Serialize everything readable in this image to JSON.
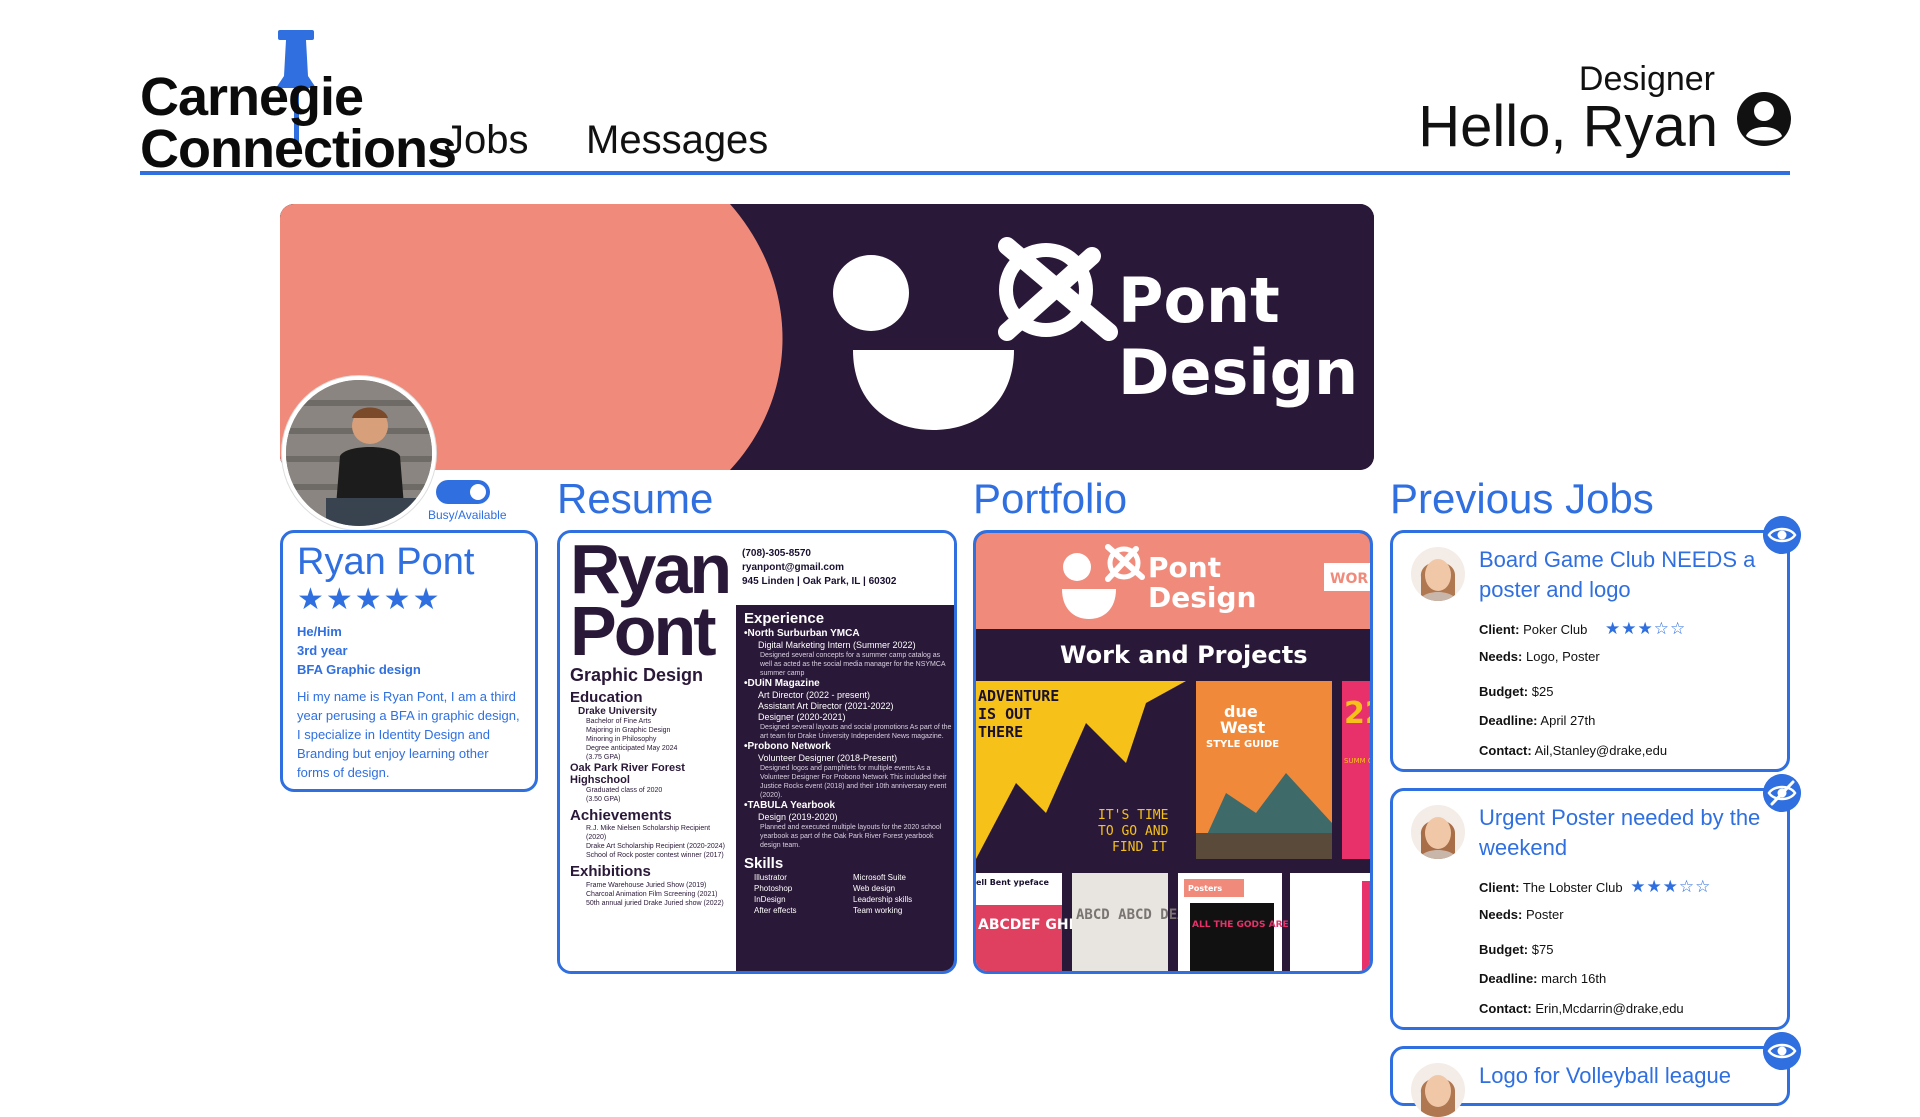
{
  "brand": {
    "line1": "Carnegie",
    "line2": "Connections"
  },
  "nav": {
    "jobs": "Jobs",
    "messages": "Messages"
  },
  "user": {
    "role": "Designer",
    "greeting": "Hello, Ryan"
  },
  "banner": {
    "brand_line1": "Pont",
    "brand_line2": "Design"
  },
  "status": {
    "toggle_label": "Busy/Available",
    "available": true
  },
  "sections": {
    "resume": "Resume",
    "portfolio": "Portfolio",
    "previous_jobs": "Previous Jobs"
  },
  "profile": {
    "name": "Ryan Pont",
    "rating": "★★★★★",
    "pronouns": "He/Him",
    "year": "3rd year",
    "program": "BFA Graphic design",
    "bio": "Hi my name is Ryan Pont, I am a third year perusing a BFA in graphic design, I specialize in Identity Design and Branding but enjoy learning other forms of design."
  },
  "resume": {
    "name_line1": "Ryan",
    "name_line2": "Pont",
    "subtitle": "Graphic Design",
    "phone": "(708)-305-8570",
    "email": "ryanpont@gmail.com",
    "address": "945 Linden | Oak Park, IL | 60302",
    "education_title": "Education",
    "edu_school1": "Drake University",
    "edu_line1": "Bachelor of Fine Arts",
    "edu_line2": "Majoring in Graphic Design",
    "edu_line3": "Minoring in Philosophy",
    "edu_line4": "Degree anticipated May 2024",
    "edu_line5": "(3.75 GPA)",
    "edu_school2": "Oak Park River Forest Highschool",
    "edu_line6": "Graduated class of 2020",
    "edu_line7": "(3.50 GPA)",
    "achievements_title": "Achievements",
    "ach1": "R.J. Mike Nielsen Scholarship Recipient (2020)",
    "ach2": "Drake Art Scholarship Recipient (2020-2024)",
    "ach3": "School of Rock poster contest winner (2017)",
    "exhibitions_title": "Exhibitions",
    "exh1": "Frame Warehouse Juried Show (2019)",
    "exh2": "Charcoal Animation Film Screening (2021)",
    "exh3": "50th annual juried Drake Juried show (2022)",
    "experience_title": "Experience",
    "exp1_org": "•North Surburban YMCA",
    "exp1_role": "Digital Marketing Intern (Summer 2022)",
    "exp1_desc": "Designed several concepts for a summer camp catalog as well as acted as the social media manager for the NSYMCA summer camp",
    "exp2_org": "•DUiN Magazine",
    "exp2_role1": "Art Director (2022 - present)",
    "exp2_role2": "Assistant Art Director (2021-2022)",
    "exp2_role3": "Designer (2020-2021)",
    "exp2_desc": "Designed several layouts and social promotions As part of the art team for Drake University Independent News magazine.",
    "exp3_org": "•Probono Network",
    "exp3_role": "Volunteer Designer (2018-Present)",
    "exp3_desc": "Designed logos and pamphlets for multiple events As a Volunteer Designer For Probono Network This included their Justice Rocks event (2018) and their 10th anniversary event (2020).",
    "exp4_org": "•TABULA Yearbook",
    "exp4_role": "Design (2019-2020)",
    "exp4_desc": "Planned and executed multiple layouts for the 2020 school yearbook as part of the Oak Park River Forest yearbook design team.",
    "skills_title": "Skills",
    "skills": [
      "Illustrator",
      "Microsoft Suite",
      "Photoshop",
      "Web design",
      "InDesign",
      "Leadership skills",
      "After effects",
      "Team working"
    ]
  },
  "portfolio": {
    "brand_line1": "Pont",
    "brand_line2": "Design",
    "tab": "WOR",
    "heading": "Work and Projects",
    "card1_text1": "ADVENTURE",
    "card1_text2": "IS OUT",
    "card1_text3": "THERE",
    "card1_tag1": "IT'S TIME",
    "card1_tag2": "TO GO AND",
    "card1_tag3": "FIND IT",
    "card2_brand1": "due",
    "card2_brand2": "West",
    "card2_sub": "STYLE GUIDE",
    "card3_big": "22",
    "card3_sub": "SUMM CAMP GUIDE",
    "bottom1": "ell Bent ypeface",
    "bottom1_letters": "ABCDEF GHIJKL",
    "bottom2_letters": "ABCD ABCD DEAD",
    "bottom3_label": "Posters",
    "bottom3_text": "ALL THE GODS ARE DEAD MUSIC FESTIVAL"
  },
  "jobs": [
    {
      "title": "Board Game Club NEEDS a poster and logo",
      "client_label": "Client:",
      "client": "Poker Club",
      "rating": "★★★☆☆",
      "needs_label": "Needs:",
      "needs": "Logo, Poster",
      "budget_label": "Budget:",
      "budget": "$25",
      "deadline_label": "Deadline:",
      "deadline": "April 27th",
      "contact_label": "Contact:",
      "contact": "Ail,Stanley@drake,edu",
      "visible": true
    },
    {
      "title": "Urgent Poster needed by the weekend",
      "client_label": "Client:",
      "client": "The Lobster Club",
      "rating": "★★★☆☆",
      "needs_label": "Needs:",
      "needs": "Poster",
      "budget_label": "Budget:",
      "budget": "$75",
      "deadline_label": "Deadline:",
      "deadline": "march 16th",
      "contact_label": "Contact:",
      "contact": "Erin,Mcdarrin@drake,edu",
      "visible": false
    },
    {
      "title": "Logo for Volleyball league",
      "visible": true
    }
  ],
  "icons": {
    "pin": "pushpin-icon",
    "account": "account-circle-icon",
    "eye": "eye-icon",
    "eye_off": "eye-off-icon"
  },
  "colors": {
    "accent": "#2f6fe0",
    "brand_dark": "#2a1838",
    "brand_salmon": "#f08b7b",
    "text": "#111111"
  }
}
